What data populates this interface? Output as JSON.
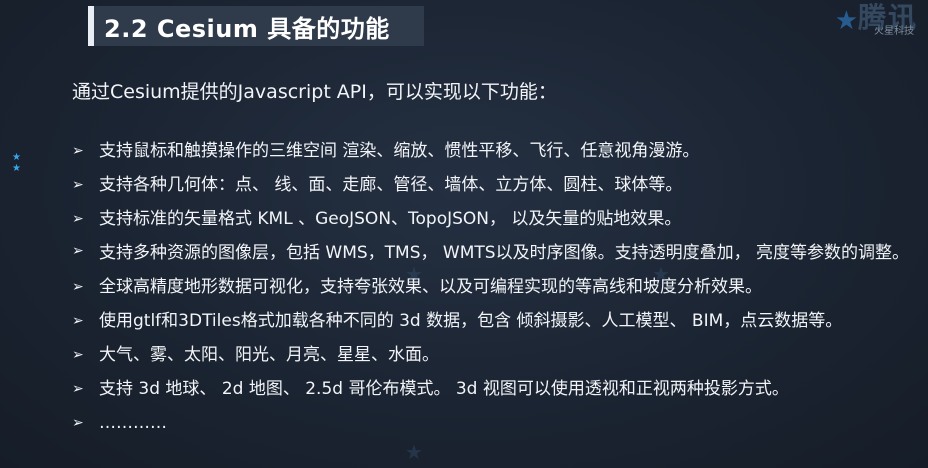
{
  "slide": {
    "title": "2.2 Cesium 具备的功能",
    "intro": "通过Cesium提供的Javascript API，可以实现以下功能：",
    "bullet_glyph": "➢",
    "items": [
      "支持鼠标和触摸操作的三维空间 渲染、缩放、惯性平移、飞行、任意视角漫游。",
      "支持各种几何体：点、 线、面、走廊、管径、墙体、立方体、圆柱、球体等。",
      "支持标准的矢量格式 KML 、GeoJSON、TopoJSON， 以及矢量的贴地效果。",
      "支持多种资源的图像层，包括 WMS，TMS， WMTS以及时序图像。支持透明度叠加， 亮度等参数的调整。",
      "全球高精度地形数据可视化，支持夸张效果、以及可编程实现的等高线和坡度分析效果。",
      "使用gtlf和3DTiles格式加载各种不同的 3d 数据，包含 倾斜摄影、人工模型、 BIM，点云数据等。",
      "大气、雾、太阳、阳光、月亮、星星、水面。",
      "支持 3d 地球、 2d 地图、 2.5d 哥伦布模式。 3d 视图可以使用透视和正视两种投影方式。",
      "…………"
    ]
  },
  "watermark": {
    "brand": "腾讯",
    "sub": "火星科技"
  },
  "colors": {
    "background": "#1b2432",
    "title_bar": "#2f3a4a",
    "accent_star": "#3aa4e8",
    "text": "#f2f4f7"
  }
}
